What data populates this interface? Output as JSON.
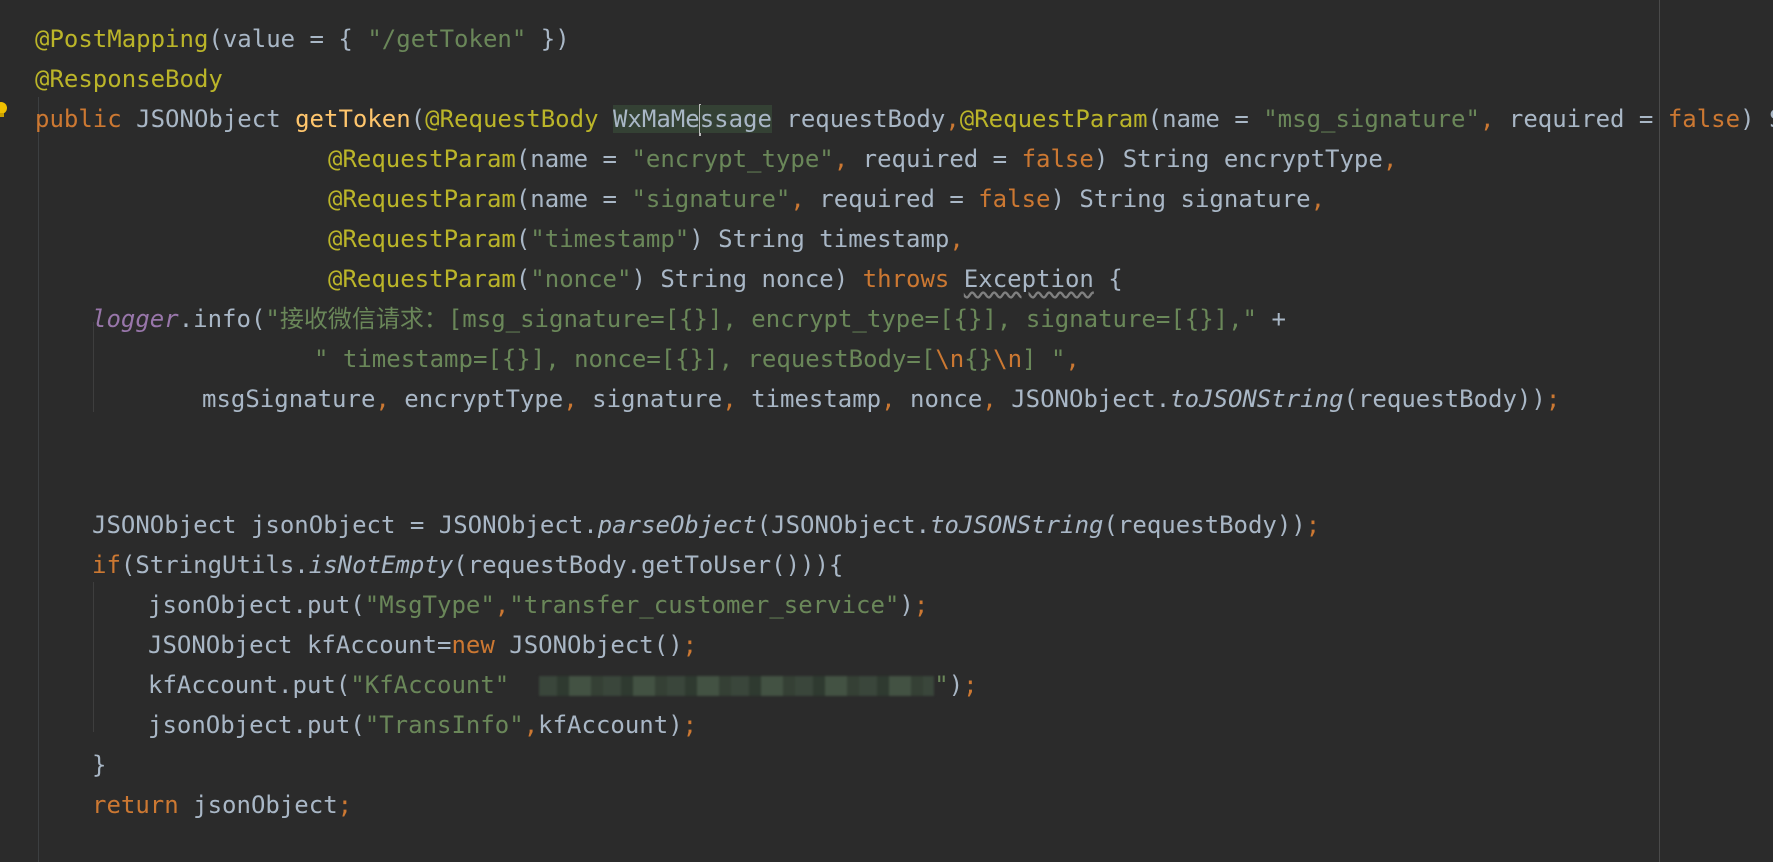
{
  "code": {
    "l1": {
      "annotation": "@PostMapping",
      "p1": "(value = { ",
      "str": "\"/getToken\"",
      "p2": " })"
    },
    "l2": {
      "annotation": "@ResponseBody"
    },
    "l3": {
      "kw": "public",
      "type": " JSONObject ",
      "fn": "getToken",
      "p1": "(",
      "ann1": "@RequestBody",
      "sp": " ",
      "hl_a": "WxMaMe",
      "hl_b": "ssage",
      "p2": " requestBody",
      "comma1": ",",
      "ann2": "@RequestParam",
      "p3": "(name = ",
      "str1": "\"msg_signature\"",
      "comma2": ",",
      "p4": " required = ",
      "kw2": "false",
      "p5": ") Stri"
    },
    "l4": {
      "ann": "@RequestParam",
      "p1": "(name = ",
      "str": "\"encrypt_type\"",
      "comma": ",",
      "p2": " required = ",
      "kw": "false",
      "p3": ") String encryptType",
      "comma2": ","
    },
    "l5": {
      "ann": "@RequestParam",
      "p1": "(name = ",
      "str": "\"signature\"",
      "comma": ",",
      "p2": " required = ",
      "kw": "false",
      "p3": ") String signature",
      "comma2": ","
    },
    "l6": {
      "ann": "@RequestParam",
      "p1": "(",
      "str": "\"timestamp\"",
      "p2": ") String timestamp",
      "comma": ","
    },
    "l7": {
      "ann": "@RequestParam",
      "p1": "(",
      "str": "\"nonce\"",
      "p2": ") String nonce) ",
      "kw": "throws",
      "sp": " ",
      "exc": "Exception",
      "p3": " {"
    },
    "l8": {
      "stat": "logger",
      "p1": ".info(",
      "str": "\"接收微信请求：[msg_signature=[{}], encrypt_type=[{}], signature=[{}],\"",
      "p2": " +"
    },
    "l9": {
      "str1": "\" timestamp=[{}], nonce=[{}], requestBody=[",
      "esc1": "\\n",
      "str2": "{}",
      "esc2": "\\n",
      "str3": "] \"",
      "comma": ","
    },
    "l10": {
      "a": "msgSignature",
      "c1": ",",
      "b": " encryptType",
      "c2": ",",
      "c": " signature",
      "c3": ",",
      "d": " timestamp",
      "c4": ",",
      "e": " nonce",
      "c5": ",",
      "f": " JSONObject.",
      "m": "toJSONString",
      "g": "(requestBody))",
      "semi": ";"
    },
    "l11": {
      "a": "JSONObject jsonObject = JSONObject.",
      "m1": "parseObject",
      "b": "(JSONObject.",
      "m2": "toJSONString",
      "c": "(requestBody))",
      "semi": ";"
    },
    "l12": {
      "kw": "if",
      "a": "(StringUtils.",
      "m": "isNotEmpty",
      "b": "(requestBody.getToUser())){"
    },
    "l13": {
      "a": "jsonObject.put(",
      "s1": "\"MsgType\"",
      "c": ",",
      "s2": "\"transfer_customer_service\"",
      "b": ")",
      "semi": ";"
    },
    "l14": {
      "a": "JSONObject kfAccount=",
      "kw": "new",
      "b": " JSONObject()",
      "semi": ";"
    },
    "l15": {
      "a": "kfAccount.put(",
      "s1": "\"KfAccount\"",
      "s2": "\"",
      "b": ")",
      "semi": ";"
    },
    "l16": {
      "a": "jsonObject.put(",
      "s1": "\"TransInfo\"",
      "c": ",",
      "b": "kfAccount)",
      "semi": ";"
    },
    "l17": {
      "a": "}"
    },
    "l18": {
      "kw": "return",
      "a": " jsonObject",
      "semi": ";"
    }
  },
  "colors": {
    "background": "#2b2b2b",
    "text": "#a9b7c6",
    "annotation": "#bbb529",
    "keyword": "#cc7832",
    "string": "#6a8759",
    "function": "#ffc66d",
    "static_field": "#9876aa"
  },
  "icons": {
    "bulb": "lightbulb-icon"
  }
}
